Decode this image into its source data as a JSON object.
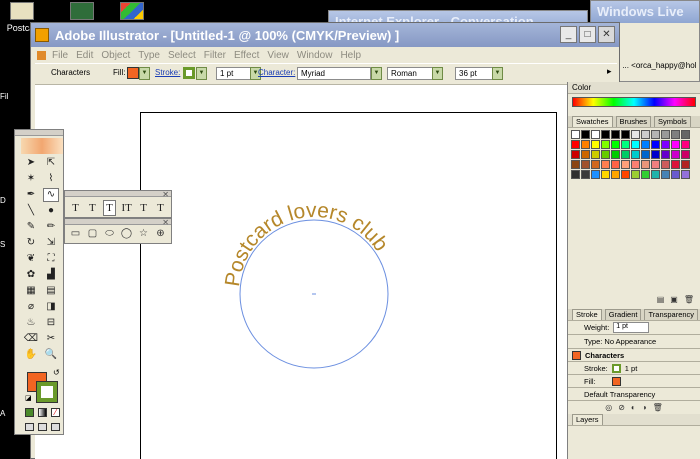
{
  "desktop": {
    "icons": [
      {
        "label": "Postcar"
      },
      {
        "label": ""
      },
      {
        "label": ""
      }
    ],
    "bg_windows": [
      {
        "title": "Internet Explorer - Conversation"
      },
      {
        "title": "Windows Live"
      }
    ],
    "bg_address": "ℹ ... <orca_happy@hol",
    "left_labels": [
      "Fil",
      "D",
      "S",
      "A"
    ]
  },
  "window": {
    "title": "Adobe Illustrator - [Untitled-1 @ 100% (CMYK/Preview) ]",
    "buttons": [
      "_",
      "□",
      "✕"
    ]
  },
  "menu": [
    "File",
    "Edit",
    "Object",
    "Type",
    "Select",
    "Filter",
    "Effect",
    "View",
    "Window",
    "Help"
  ],
  "control": {
    "mode": "Characters",
    "fill_label": "Fill:",
    "stroke_label": "Stroke:",
    "stroke_weight": "1 pt",
    "character_label": "Character:",
    "font_family": "Myriad",
    "font_style": "Roman",
    "font_size": "36 pt",
    "fill_color": "#f26522",
    "stroke_color": "#8dc63f"
  },
  "artwork": {
    "path_text": "Postcard lovers club",
    "text_color": "#b5872a",
    "circle_color": "#6b8fe0"
  },
  "type_palette": {
    "tools": [
      "T",
      "T",
      "T",
      "IT",
      "T",
      "T"
    ]
  },
  "shape_palette": {
    "tools": [
      "▭",
      "▢",
      "⬭",
      "◯",
      "☆",
      "⊕"
    ]
  },
  "panels": {
    "color_title": "Color",
    "swatch_tabs": [
      "Swatches",
      "Brushes",
      "Symbols"
    ],
    "stroke_tabs": [
      "Stroke",
      "Gradient",
      "Transparency"
    ],
    "weight_label": "Weight:",
    "weight_value": "1 pt",
    "appearance_type": "Type: No Appearance",
    "appearance_characters": "Characters",
    "appearance_stroke_label": "Stroke:",
    "appearance_stroke_value": "1 pt",
    "appearance_fill_label": "Fill:",
    "appearance_default": "Default Transparency",
    "layers_title": "Layers"
  },
  "swatches": [
    "#ffffff",
    "#000000",
    "#ffffff",
    "#000000",
    "#000000",
    "#000000",
    "#e6e6e6",
    "#cccccc",
    "#b3b3b3",
    "#999999",
    "#808080",
    "#666666",
    "#ff0000",
    "#ff8000",
    "#ffff00",
    "#80ff00",
    "#00ff00",
    "#00ff80",
    "#00ffff",
    "#0080ff",
    "#0000ff",
    "#8000ff",
    "#ff00ff",
    "#ff0080",
    "#cc0000",
    "#cc6600",
    "#cccc00",
    "#66cc00",
    "#00cc00",
    "#00cc66",
    "#00cccc",
    "#0066cc",
    "#0000cc",
    "#6600cc",
    "#cc00cc",
    "#cc0066",
    "#8b4513",
    "#a0522d",
    "#d2691e",
    "#ff7f50",
    "#ff6347",
    "#ffa07a",
    "#fa8072",
    "#e9967a",
    "#f08080",
    "#cd5c5c",
    "#dc143c",
    "#b22222",
    "#2f2f2f",
    "#3a3a3a",
    "#1e90ff",
    "#ffd700",
    "#ffa500",
    "#ff4500",
    "#9acd32",
    "#32cd32",
    "#20b2aa",
    "#4682b4",
    "#6a5acd",
    "#9370db"
  ]
}
